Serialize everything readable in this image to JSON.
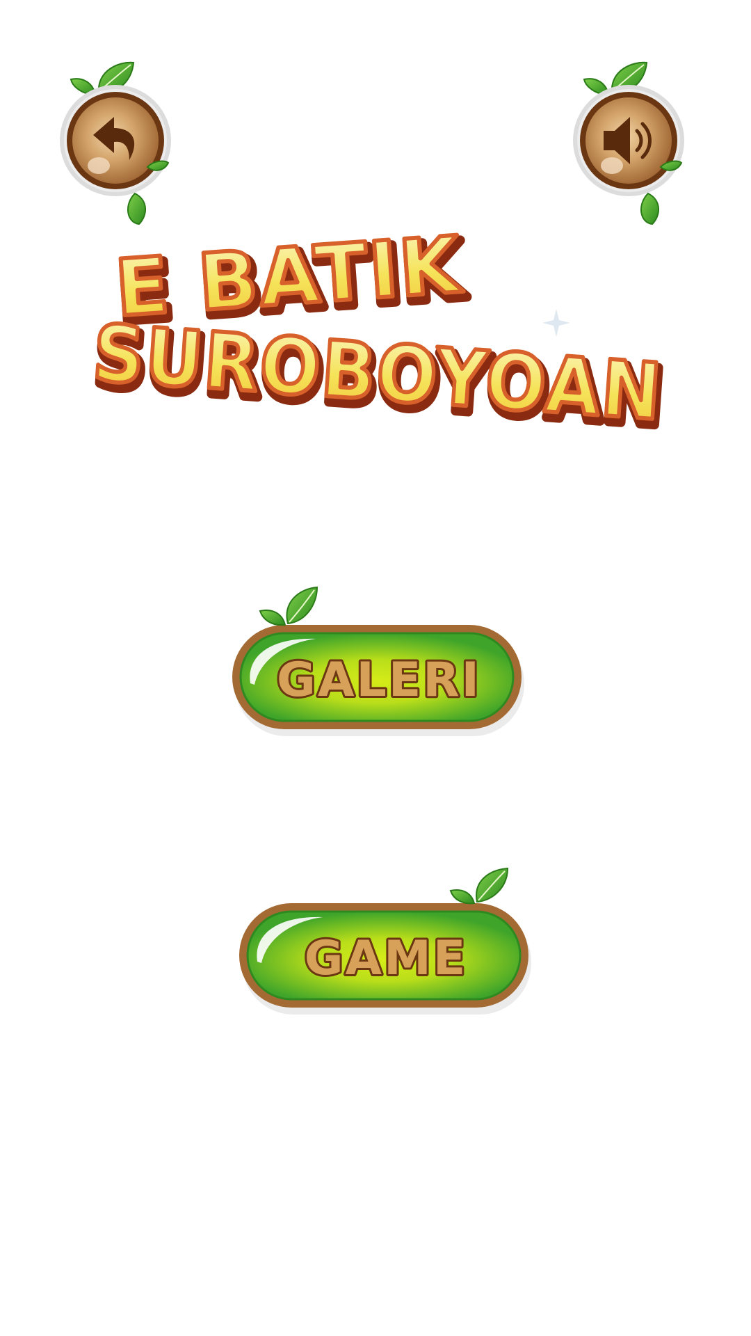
{
  "title": {
    "line1": "E BATIK",
    "line2": "SUROBOYOAN"
  },
  "buttons": {
    "galeri": "GALERI",
    "game": "GAME"
  },
  "icons": {
    "back": "undo-arrow-icon",
    "sound": "speaker-icon",
    "leaf": "leaf-icon"
  },
  "colors": {
    "wood_dark": "#6b3612",
    "wood_light": "#c48a4f",
    "leaf_green": "#3f9e2a",
    "button_green": "#45a82a",
    "button_lime": "#c8e41a",
    "title_yellow": "#f6e86a",
    "title_outline": "#b84a22"
  }
}
